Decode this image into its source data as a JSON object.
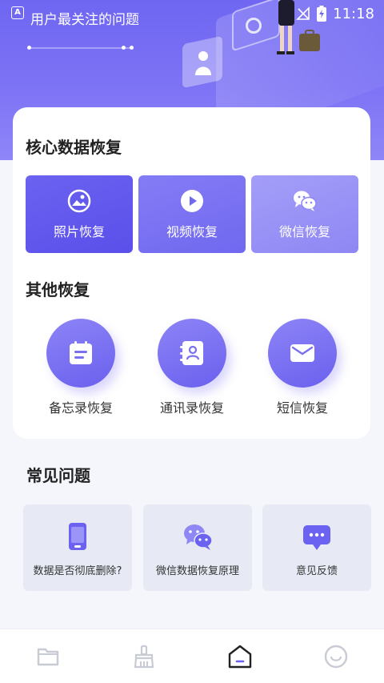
{
  "status_bar": {
    "app_badge": "A",
    "time": "11:18"
  },
  "header": {
    "title": "用户最关注的问题"
  },
  "core_recovery": {
    "title": "核心数据恢复",
    "items": [
      {
        "label": "照片恢复",
        "icon": "image-icon"
      },
      {
        "label": "视频恢复",
        "icon": "play-icon"
      },
      {
        "label": "微信恢复",
        "icon": "wechat-icon"
      }
    ]
  },
  "other_recovery": {
    "title": "其他恢复",
    "items": [
      {
        "label": "备忘录恢复",
        "icon": "memo-icon"
      },
      {
        "label": "通讯录恢复",
        "icon": "contacts-icon"
      },
      {
        "label": "短信恢复",
        "icon": "mail-icon"
      }
    ]
  },
  "faq": {
    "title": "常见问题",
    "items": [
      {
        "label": "数据是否彻底删除?",
        "icon": "phone-icon"
      },
      {
        "label": "微信数据恢复原理",
        "icon": "wechat-icon"
      },
      {
        "label": "意见反馈",
        "icon": "chat-bubble-icon"
      }
    ]
  },
  "bottom_nav": {
    "items": [
      {
        "icon": "folder-icon",
        "active": false
      },
      {
        "icon": "broom-icon",
        "active": false
      },
      {
        "icon": "home-icon",
        "active": true
      },
      {
        "icon": "smile-icon",
        "active": false
      }
    ]
  },
  "colors": {
    "accent": "#6b62f1",
    "accent_light": "#a49ef8",
    "faq_bg": "#e7eaf4"
  }
}
